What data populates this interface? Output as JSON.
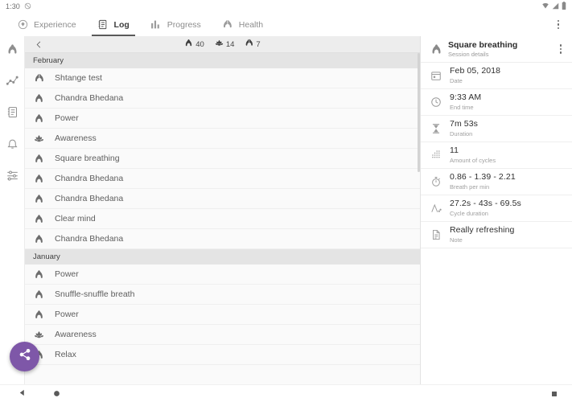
{
  "statusbar": {
    "time": "1:30",
    "left_icon": "no-alarm-icon",
    "right_icons": [
      "wifi-icon",
      "signal-icon",
      "battery-icon"
    ]
  },
  "topbar": {
    "tabs": [
      {
        "label": "Experience",
        "icon": "drop-shield-icon",
        "active": false
      },
      {
        "label": "Log",
        "icon": "journal-icon",
        "active": true
      },
      {
        "label": "Progress",
        "icon": "bar-chart-icon",
        "active": false
      },
      {
        "label": "Health",
        "icon": "heart-lungs-icon",
        "active": false
      }
    ],
    "overflow_icon": "more-vertical-icon"
  },
  "rail": {
    "items": [
      {
        "icon": "lungs-icon",
        "name": "breathing"
      },
      {
        "icon": "line-chart-icon",
        "name": "statistics"
      },
      {
        "icon": "journal-icon",
        "name": "log"
      },
      {
        "icon": "bell-icon",
        "name": "reminders"
      },
      {
        "icon": "sliders-icon",
        "name": "settings"
      }
    ]
  },
  "list": {
    "back_icon": "chevron-left-icon",
    "counters": [
      {
        "icon": "lungs-icon",
        "value": "40"
      },
      {
        "icon": "lotus-icon",
        "value": "14"
      },
      {
        "icon": "heart-lungs-icon",
        "value": "7"
      }
    ],
    "groups": [
      {
        "month": "February",
        "entries": [
          {
            "label": "Shtange test",
            "icon": "heart-lungs-icon"
          },
          {
            "label": "Chandra Bhedana",
            "icon": "lungs-icon"
          },
          {
            "label": "Power",
            "icon": "lungs-icon"
          },
          {
            "label": "Awareness",
            "icon": "lotus-icon"
          },
          {
            "label": "Square breathing",
            "icon": "lungs-icon"
          },
          {
            "label": "Chandra Bhedana",
            "icon": "lungs-icon"
          },
          {
            "label": "Chandra Bhedana",
            "icon": "lungs-icon"
          },
          {
            "label": "Clear mind",
            "icon": "lungs-icon"
          },
          {
            "label": "Chandra Bhedana",
            "icon": "lungs-icon"
          }
        ]
      },
      {
        "month": "January",
        "entries": [
          {
            "label": "Power",
            "icon": "lungs-icon"
          },
          {
            "label": "Snuffle-snuffle breath",
            "icon": "lungs-icon"
          },
          {
            "label": "Power",
            "icon": "lungs-icon"
          },
          {
            "label": "Awareness",
            "icon": "lotus-icon"
          },
          {
            "label": "Relax",
            "icon": "lungs-icon"
          }
        ]
      }
    ]
  },
  "detail": {
    "title": "Square breathing",
    "subtitle": "Session details",
    "title_icon": "lungs-icon",
    "overflow_icon": "more-vertical-icon",
    "rows": [
      {
        "value": "Feb 05, 2018",
        "label": "Date",
        "icon": "calendar-icon"
      },
      {
        "value": "9:33 AM",
        "label": "End time",
        "icon": "clock-icon"
      },
      {
        "value": "7m 53s",
        "label": "Duration",
        "icon": "hourglass-icon"
      },
      {
        "value": "11",
        "label": "Amount of cycles",
        "icon": "dots-grid-icon"
      },
      {
        "value": "0.86  -  1.39  -  2.21",
        "label": "Breath per min",
        "icon": "stopwatch-icon"
      },
      {
        "value": "27.2s  -  43s  -  69.5s",
        "label": "Cycle duration",
        "icon": "cycle-graph-icon"
      },
      {
        "value": "Really refreshing",
        "label": "Note",
        "icon": "note-icon"
      }
    ]
  },
  "fab": {
    "icon": "share-icon",
    "color": "#7e57a8"
  },
  "navbar": {
    "back_icon": "triangle-back-icon",
    "home_icon": "circle-home-icon",
    "recents_icon": "square-recents-icon"
  }
}
